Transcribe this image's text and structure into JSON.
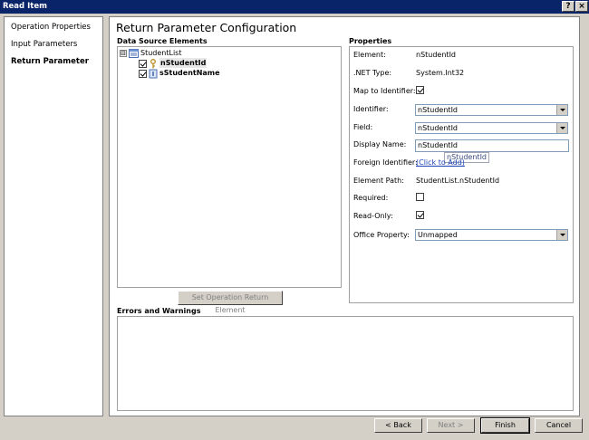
{
  "window": {
    "title": "Read Item",
    "help_label": "?",
    "close_label": "×"
  },
  "nav": {
    "items": [
      {
        "label": "Operation Properties"
      },
      {
        "label": "Input Parameters"
      },
      {
        "label": "Return Parameter"
      }
    ]
  },
  "main": {
    "title": "Return Parameter Configuration"
  },
  "data_source": {
    "heading": "Data Source Elements",
    "root": {
      "label": "StudentList",
      "expander": "⊟"
    },
    "children": [
      {
        "label": "nStudentId",
        "checked": true,
        "selected": true
      },
      {
        "label": "sStudentName",
        "checked": true,
        "selected": false
      }
    ],
    "set_return_button": "Set Operation Return Element"
  },
  "properties": {
    "heading": "Properties",
    "element": {
      "label": "Element:",
      "value": "nStudentId"
    },
    "net_type": {
      "label": ".NET Type:",
      "value": "System.Int32"
    },
    "map_to_identifier": {
      "label": "Map to Identifier:",
      "checked": true
    },
    "identifier": {
      "label": "Identifier:",
      "value": "nStudentId"
    },
    "field": {
      "label": "Field:",
      "value": "nStudentId"
    },
    "display_name": {
      "label": "Display Name:",
      "value": "nStudentId",
      "tooltip": "nStudentId"
    },
    "foreign_identifier": {
      "label": "Foreign Identifier:",
      "link": "(Click to Add)"
    },
    "element_path": {
      "label": "Element Path:",
      "value": "StudentList.nStudentId"
    },
    "required": {
      "label": "Required:",
      "checked": false
    },
    "read_only": {
      "label": "Read-Only:",
      "checked": true
    },
    "office_property": {
      "label": "Office Property:",
      "value": "Unmapped"
    }
  },
  "errors": {
    "heading": "Errors and Warnings"
  },
  "footer": {
    "back": "< Back",
    "next": "Next >",
    "finish": "Finish",
    "cancel": "Cancel"
  }
}
